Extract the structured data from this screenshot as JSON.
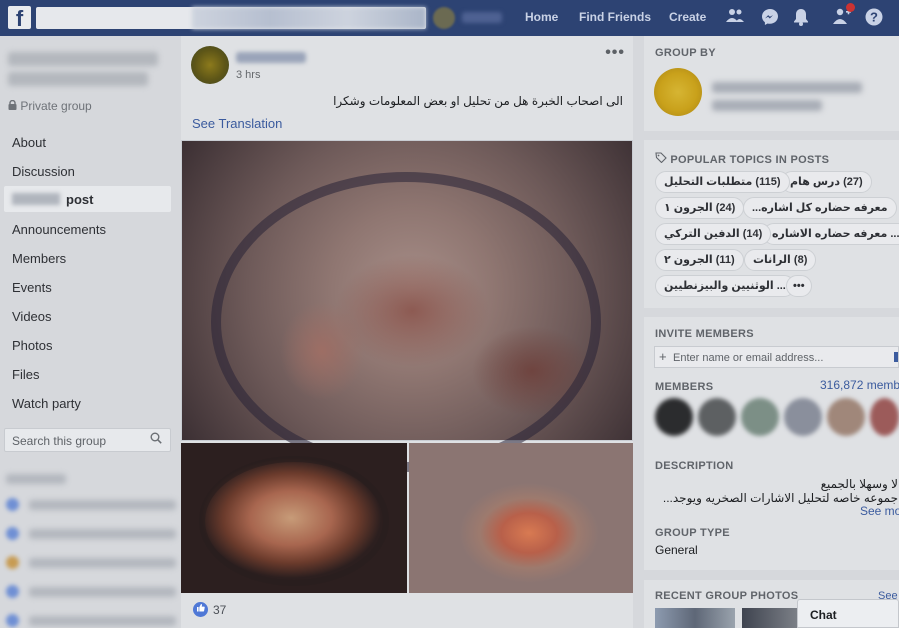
{
  "topbar": {
    "logo": "f",
    "nav": [
      "Home",
      "Find Friends",
      "Create"
    ],
    "icons": [
      "friends-icon",
      "messenger-icon",
      "notifications-icon",
      "friend-requests-icon",
      "help-icon"
    ],
    "help_glyph": "?"
  },
  "sidebar": {
    "privacy": "Private group",
    "items": [
      "About",
      "Discussion",
      "post",
      "Announcements",
      "Members",
      "Events",
      "Videos",
      "Photos",
      "Files",
      "Watch party"
    ],
    "search_placeholder": "Search this group"
  },
  "post": {
    "time": "3 hrs",
    "more": "•••",
    "text": "الى اصحاب الخبرة هل من تحليل او بعض المعلومات وشكرا",
    "see_translation": "See Translation",
    "likes": "37"
  },
  "right": {
    "group_by_title": "GROUP BY",
    "popular_title": "POPULAR TOPICS IN POSTS",
    "topics": [
      "(27) درس هام",
      "(115) متطلبات التحليل",
      "معرفه حضاره كل اشاره...",
      "(24) الجرون ١",
      "... معرفه حضاره الاشاره",
      "(14) الدفين التركي",
      "(8) الرانات",
      "(11) الجرون ٢",
      "... الوثنيين والبيزنطيين"
    ],
    "topics_more": "•••",
    "invite_title": "INVITE MEMBERS",
    "invite_placeholder": "Enter name or email address...",
    "members_title": "MEMBERS",
    "members_count": "316,872 membe",
    "description_title": "DESCRIPTION",
    "description_lines": [
      "لا وسهلا بالجميع",
      "جموعه خاصه لتحليل الاشارات الصخريه ويوجد..."
    ],
    "see_more": "See mo",
    "group_type_title": "GROUP TYPE",
    "group_type": "General",
    "recent_photos_title": "RECENT GROUP PHOTOS",
    "recent_see": "See"
  },
  "chat": {
    "label": "Chat"
  }
}
